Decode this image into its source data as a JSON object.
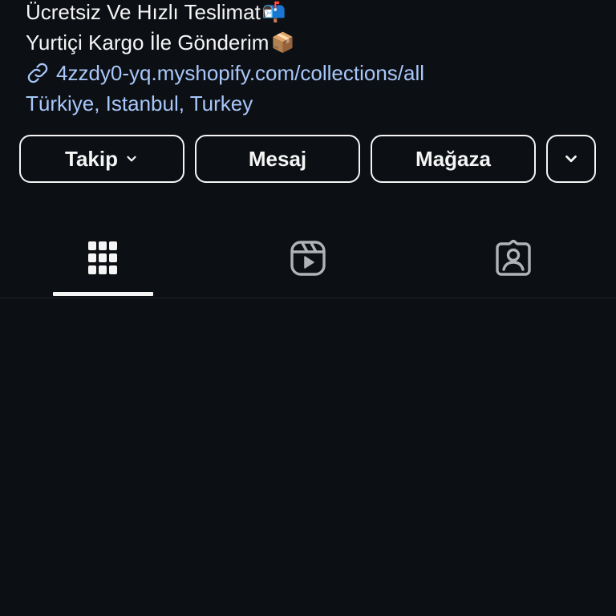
{
  "bio": {
    "line1_text": "Ücretsiz Ve Hızlı Teslimat",
    "line1_emoji": "📬",
    "line2_text": "Yurtiçi Kargo İle Gönderim",
    "line2_emoji": "📦",
    "link_text": "4zzdy0-yq.myshopify.com/collections/all",
    "location": "Türkiye, Istanbul, Turkey",
    "link_icon": "link-icon"
  },
  "actions": {
    "follow_label": "Takip",
    "message_label": "Mesaj",
    "store_label": "Mağaza",
    "follow_icon": "chevron-down-icon",
    "more_icon": "chevron-down-icon"
  },
  "tabs": [
    {
      "name": "grid",
      "icon": "grid-icon",
      "selected": true
    },
    {
      "name": "reels",
      "icon": "reels-icon",
      "selected": false
    },
    {
      "name": "tagged",
      "icon": "tagged-person-icon",
      "selected": false
    }
  ],
  "colors": {
    "background": "#0c0f14",
    "text": "#f5f5f5",
    "link": "#a8c7fa"
  }
}
